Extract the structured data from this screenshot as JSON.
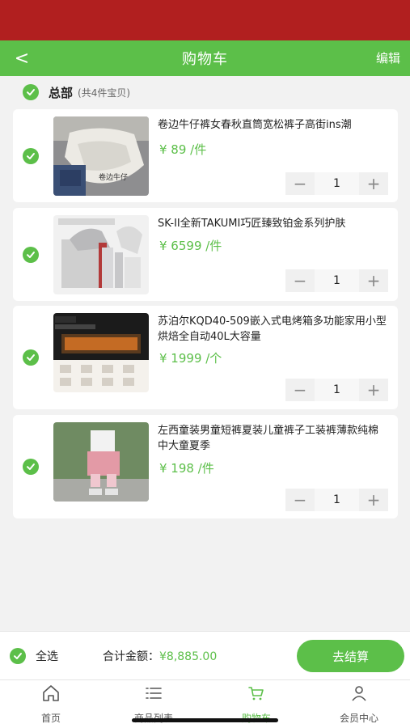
{
  "header": {
    "back_glyph": "<",
    "title": "购物车",
    "edit_label": "编辑"
  },
  "summary": {
    "label": "总部",
    "count_text": "(共4件宝贝)"
  },
  "items": [
    {
      "name": "卷边牛仔裤女春秋直筒宽松裤子高街ins潮",
      "price": "¥ 89 /件",
      "qty": "1",
      "image": "jeans-photo"
    },
    {
      "name": "SK-II全新TAKUMI巧匠臻致铂金系列护肤",
      "price": "¥ 6599 /件",
      "qty": "1",
      "image": "skincare-photo"
    },
    {
      "name": "苏泊尔KQD40-509嵌入式电烤箱多功能家用小型烘焙全自动40L大容量",
      "price": "¥ 1999 /个",
      "qty": "1",
      "image": "oven-photo"
    },
    {
      "name": "左西童装男童短裤夏装儿童裤子工装裤薄款纯棉中大童夏季",
      "price": "¥ 198 /件",
      "qty": "1",
      "image": "kids-shorts-photo"
    }
  ],
  "footer": {
    "select_all_label": "全选",
    "total_label": "合计金额：",
    "total_amount": "¥8,885.00",
    "checkout_label": "去结算"
  },
  "tabs": [
    {
      "label": "首页",
      "icon": "home-icon"
    },
    {
      "label": "商品列表",
      "icon": "list-icon"
    },
    {
      "label": "购物车",
      "icon": "cart-icon",
      "active": true
    },
    {
      "label": "会员中心",
      "icon": "user-icon"
    }
  ],
  "colors": {
    "accent": "#5cbf49",
    "status_bar": "#b11f1f",
    "background": "#f2f2f2"
  }
}
